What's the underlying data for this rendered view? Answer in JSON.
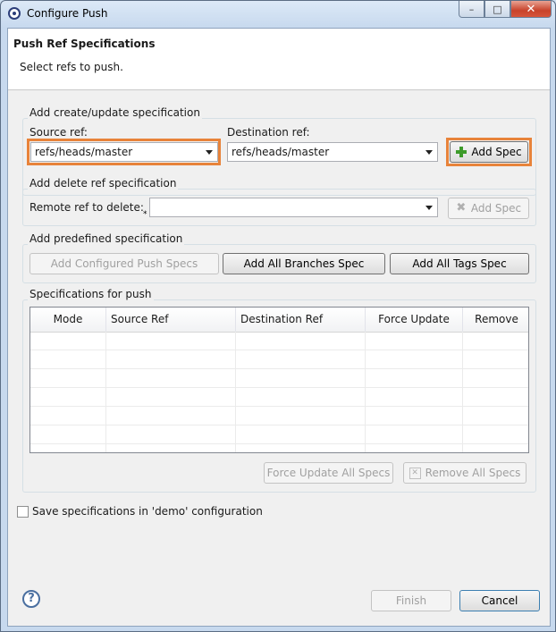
{
  "window": {
    "title": "Configure Push",
    "minimize_glyph": "–",
    "maximize_glyph": "□",
    "close_glyph": "✕"
  },
  "header": {
    "title": "Push Ref Specifications",
    "description": "Select refs to push."
  },
  "create_update": {
    "group_label": "Add create/update specification",
    "source_label": "Source ref:",
    "source_value": "refs/heads/master",
    "destination_label": "Destination ref:",
    "destination_value": "refs/heads/master",
    "add_button": "Add Spec"
  },
  "delete_spec": {
    "group_label": "Add delete ref specification",
    "remote_label": "Remote ref to delete:",
    "remote_value": "",
    "required_marker": "*",
    "add_button": "Add Spec"
  },
  "predefined": {
    "group_label": "Add predefined specification",
    "configured_button": "Add Configured Push Specs",
    "all_branches_button": "Add All Branches Spec",
    "all_tags_button": "Add All Tags Spec"
  },
  "specs": {
    "group_label": "Specifications for push",
    "columns": [
      "Mode",
      "Source Ref",
      "Destination Ref",
      "Force Update",
      "Remove"
    ],
    "force_update_all_button": "Force Update All Specs",
    "remove_all_button": "Remove All Specs"
  },
  "save_config": {
    "label": "Save specifications in 'demo' configuration",
    "checked": false
  },
  "footer": {
    "help_glyph": "?",
    "finish_button": "Finish",
    "cancel_button": "Cancel"
  },
  "colors": {
    "highlight": "#e8833a",
    "add_icon": "#3d9b2a",
    "title_gradient": "#c7d9ee"
  }
}
